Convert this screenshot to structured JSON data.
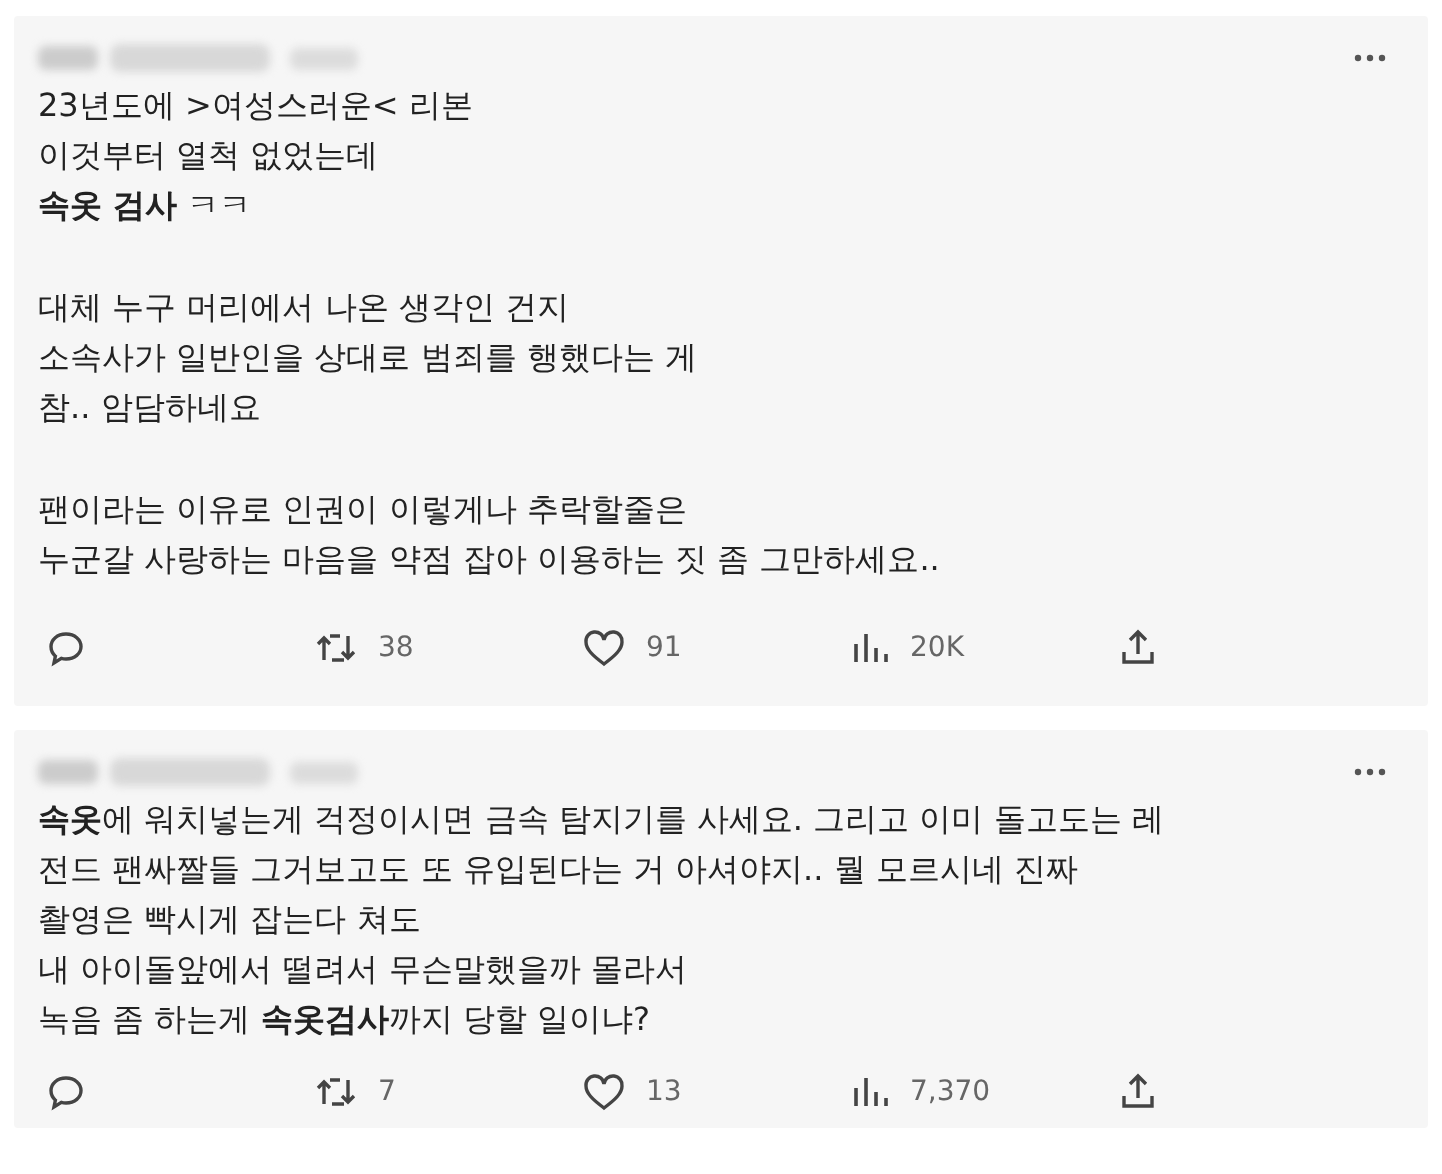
{
  "posts": [
    {
      "author_redacted": true,
      "paragraphs": [
        [
          "23년도에 >여성스러운< 리본",
          "이것부터 열척 없었는데",
          "**속옷 검사** ㅋㅋ"
        ],
        [
          "대체 누구 머리에서 나온 생각인 건지",
          "소속사가 일반인을 상대로 범죄를 행했다는 게",
          "참.. 암담하네요"
        ],
        [
          "팬이라는 이유로 인권이 이렇게나 추락할줄은",
          "누군갈 사랑하는 마음을 약점 잡아 이용하는 짓 좀 그만하세요.."
        ]
      ],
      "actions": [
        {
          "kind": "reply"
        },
        {
          "kind": "repost",
          "count": "38"
        },
        {
          "kind": "like",
          "count": "91"
        },
        {
          "kind": "views",
          "count": "20K"
        },
        {
          "kind": "share"
        }
      ]
    },
    {
      "author_redacted": true,
      "paragraphs": [
        [
          "**속옷**에 워치넣는게 걱정이시면 금속 탐지기를 사세요. 그리고 이미 돌고도는 레",
          "전드 팬싸짤들 그거보고도 또 유입된다는 거 아셔야지.. 뭘 모르시네 진짜",
          "촬영은 빡시게 잡는다 쳐도",
          "내 아이돌앞에서 떨려서 무슨말했을까 몰라서",
          "녹음 좀 하는게 **속옷검사**까지 당할 일이냐?"
        ]
      ],
      "actions": [
        {
          "kind": "reply"
        },
        {
          "kind": "repost",
          "count": "7"
        },
        {
          "kind": "like",
          "count": "13"
        },
        {
          "kind": "views",
          "count": "7,370"
        },
        {
          "kind": "share"
        }
      ]
    }
  ]
}
